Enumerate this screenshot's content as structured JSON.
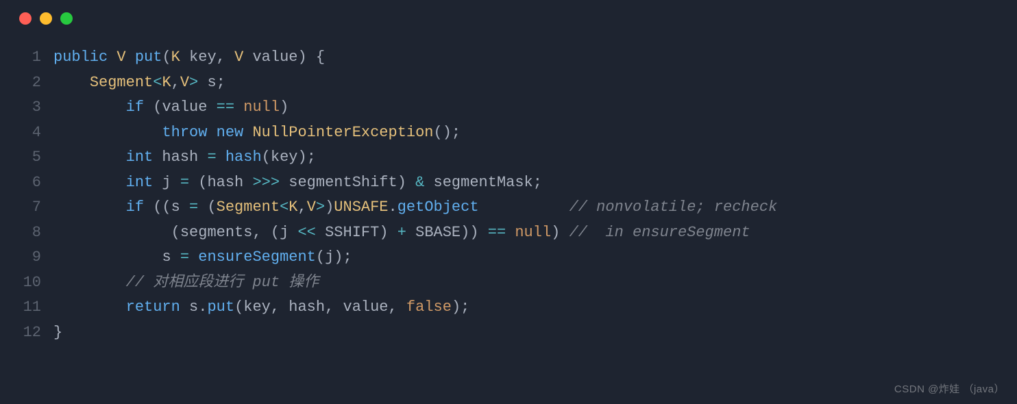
{
  "window": {
    "dots": [
      "red",
      "yellow",
      "green"
    ]
  },
  "watermark": "CSDN @炸娃 （java）",
  "code": {
    "lines": [
      {
        "n": "1",
        "tokens": [
          {
            "c": "tok-keyword",
            "t": "public"
          },
          {
            "c": "tok-plain",
            "t": " "
          },
          {
            "c": "tok-type",
            "t": "V"
          },
          {
            "c": "tok-plain",
            "t": " "
          },
          {
            "c": "tok-func",
            "t": "put"
          },
          {
            "c": "tok-punct",
            "t": "("
          },
          {
            "c": "tok-type",
            "t": "K"
          },
          {
            "c": "tok-plain",
            "t": " key, "
          },
          {
            "c": "tok-type",
            "t": "V"
          },
          {
            "c": "tok-plain",
            "t": " value"
          },
          {
            "c": "tok-punct",
            "t": ")"
          },
          {
            "c": "tok-plain",
            "t": " "
          },
          {
            "c": "tok-punct",
            "t": "{"
          }
        ]
      },
      {
        "n": "2",
        "tokens": [
          {
            "c": "tok-plain",
            "t": "    "
          },
          {
            "c": "tok-class",
            "t": "Segment"
          },
          {
            "c": "tok-op",
            "t": "<"
          },
          {
            "c": "tok-type",
            "t": "K"
          },
          {
            "c": "tok-punct",
            "t": ","
          },
          {
            "c": "tok-type",
            "t": "V"
          },
          {
            "c": "tok-op",
            "t": ">"
          },
          {
            "c": "tok-plain",
            "t": " s"
          },
          {
            "c": "tok-punct",
            "t": ";"
          }
        ]
      },
      {
        "n": "3",
        "tokens": [
          {
            "c": "tok-plain",
            "t": "        "
          },
          {
            "c": "tok-keyword",
            "t": "if"
          },
          {
            "c": "tok-plain",
            "t": " "
          },
          {
            "c": "tok-punct",
            "t": "("
          },
          {
            "c": "tok-plain",
            "t": "value "
          },
          {
            "c": "tok-op",
            "t": "=="
          },
          {
            "c": "tok-plain",
            "t": " "
          },
          {
            "c": "tok-null",
            "t": "null"
          },
          {
            "c": "tok-punct",
            "t": ")"
          }
        ]
      },
      {
        "n": "4",
        "tokens": [
          {
            "c": "tok-plain",
            "t": "            "
          },
          {
            "c": "tok-keyword",
            "t": "throw"
          },
          {
            "c": "tok-plain",
            "t": " "
          },
          {
            "c": "tok-keyword",
            "t": "new"
          },
          {
            "c": "tok-plain",
            "t": " "
          },
          {
            "c": "tok-class",
            "t": "NullPointerException"
          },
          {
            "c": "tok-punct",
            "t": "()"
          },
          {
            "c": "tok-punct",
            "t": ";"
          }
        ]
      },
      {
        "n": "5",
        "tokens": [
          {
            "c": "tok-plain",
            "t": "        "
          },
          {
            "c": "tok-keyword",
            "t": "int"
          },
          {
            "c": "tok-plain",
            "t": " hash "
          },
          {
            "c": "tok-op",
            "t": "="
          },
          {
            "c": "tok-plain",
            "t": " "
          },
          {
            "c": "tok-func",
            "t": "hash"
          },
          {
            "c": "tok-punct",
            "t": "("
          },
          {
            "c": "tok-plain",
            "t": "key"
          },
          {
            "c": "tok-punct",
            "t": ")"
          },
          {
            "c": "tok-punct",
            "t": ";"
          }
        ]
      },
      {
        "n": "6",
        "tokens": [
          {
            "c": "tok-plain",
            "t": "        "
          },
          {
            "c": "tok-keyword",
            "t": "int"
          },
          {
            "c": "tok-plain",
            "t": " j "
          },
          {
            "c": "tok-op",
            "t": "="
          },
          {
            "c": "tok-plain",
            "t": " "
          },
          {
            "c": "tok-punct",
            "t": "("
          },
          {
            "c": "tok-plain",
            "t": "hash "
          },
          {
            "c": "tok-op",
            "t": ">>>"
          },
          {
            "c": "tok-plain",
            "t": " segmentShift"
          },
          {
            "c": "tok-punct",
            "t": ")"
          },
          {
            "c": "tok-plain",
            "t": " "
          },
          {
            "c": "tok-op",
            "t": "&"
          },
          {
            "c": "tok-plain",
            "t": " segmentMask"
          },
          {
            "c": "tok-punct",
            "t": ";"
          }
        ]
      },
      {
        "n": "7",
        "tokens": [
          {
            "c": "tok-plain",
            "t": "        "
          },
          {
            "c": "tok-keyword",
            "t": "if"
          },
          {
            "c": "tok-plain",
            "t": " "
          },
          {
            "c": "tok-punct",
            "t": "(("
          },
          {
            "c": "tok-plain",
            "t": "s "
          },
          {
            "c": "tok-op",
            "t": "="
          },
          {
            "c": "tok-plain",
            "t": " "
          },
          {
            "c": "tok-punct",
            "t": "("
          },
          {
            "c": "tok-class",
            "t": "Segment"
          },
          {
            "c": "tok-op",
            "t": "<"
          },
          {
            "c": "tok-type",
            "t": "K"
          },
          {
            "c": "tok-punct",
            "t": ","
          },
          {
            "c": "tok-type",
            "t": "V"
          },
          {
            "c": "tok-op",
            "t": ">"
          },
          {
            "c": "tok-punct",
            "t": ")"
          },
          {
            "c": "tok-class",
            "t": "UNSAFE"
          },
          {
            "c": "tok-punct",
            "t": "."
          },
          {
            "c": "tok-func",
            "t": "getObject"
          },
          {
            "c": "tok-plain",
            "t": "          "
          },
          {
            "c": "tok-comment",
            "t": "// nonvolatile; recheck"
          }
        ]
      },
      {
        "n": "8",
        "tokens": [
          {
            "c": "tok-plain",
            "t": "             "
          },
          {
            "c": "tok-punct",
            "t": "("
          },
          {
            "c": "tok-plain",
            "t": "segments"
          },
          {
            "c": "tok-punct",
            "t": ","
          },
          {
            "c": "tok-plain",
            "t": " "
          },
          {
            "c": "tok-punct",
            "t": "("
          },
          {
            "c": "tok-plain",
            "t": "j "
          },
          {
            "c": "tok-op",
            "t": "<<"
          },
          {
            "c": "tok-plain",
            "t": " SSHIFT"
          },
          {
            "c": "tok-punct",
            "t": ")"
          },
          {
            "c": "tok-plain",
            "t": " "
          },
          {
            "c": "tok-op",
            "t": "+"
          },
          {
            "c": "tok-plain",
            "t": " SBASE"
          },
          {
            "c": "tok-punct",
            "t": "))"
          },
          {
            "c": "tok-plain",
            "t": " "
          },
          {
            "c": "tok-op",
            "t": "=="
          },
          {
            "c": "tok-plain",
            "t": " "
          },
          {
            "c": "tok-null",
            "t": "null"
          },
          {
            "c": "tok-punct",
            "t": ")"
          },
          {
            "c": "tok-plain",
            "t": " "
          },
          {
            "c": "tok-comment",
            "t": "//  in ensureSegment"
          }
        ]
      },
      {
        "n": "9",
        "tokens": [
          {
            "c": "tok-plain",
            "t": "            "
          },
          {
            "c": "tok-plain",
            "t": "s "
          },
          {
            "c": "tok-op",
            "t": "="
          },
          {
            "c": "tok-plain",
            "t": " "
          },
          {
            "c": "tok-func",
            "t": "ensureSegment"
          },
          {
            "c": "tok-punct",
            "t": "("
          },
          {
            "c": "tok-plain",
            "t": "j"
          },
          {
            "c": "tok-punct",
            "t": ")"
          },
          {
            "c": "tok-punct",
            "t": ";"
          }
        ]
      },
      {
        "n": "10",
        "tokens": [
          {
            "c": "tok-plain",
            "t": "        "
          },
          {
            "c": "tok-comment",
            "t": "// 对相应段进行 put 操作"
          }
        ]
      },
      {
        "n": "11",
        "tokens": [
          {
            "c": "tok-plain",
            "t": "        "
          },
          {
            "c": "tok-keyword",
            "t": "return"
          },
          {
            "c": "tok-plain",
            "t": " s"
          },
          {
            "c": "tok-punct",
            "t": "."
          },
          {
            "c": "tok-func",
            "t": "put"
          },
          {
            "c": "tok-punct",
            "t": "("
          },
          {
            "c": "tok-plain",
            "t": "key"
          },
          {
            "c": "tok-punct",
            "t": ","
          },
          {
            "c": "tok-plain",
            "t": " hash"
          },
          {
            "c": "tok-punct",
            "t": ","
          },
          {
            "c": "tok-plain",
            "t": " value"
          },
          {
            "c": "tok-punct",
            "t": ","
          },
          {
            "c": "tok-plain",
            "t": " "
          },
          {
            "c": "tok-bool",
            "t": "false"
          },
          {
            "c": "tok-punct",
            "t": ")"
          },
          {
            "c": "tok-punct",
            "t": ";"
          }
        ]
      },
      {
        "n": "12",
        "tokens": [
          {
            "c": "tok-punct",
            "t": "}"
          }
        ]
      }
    ]
  }
}
